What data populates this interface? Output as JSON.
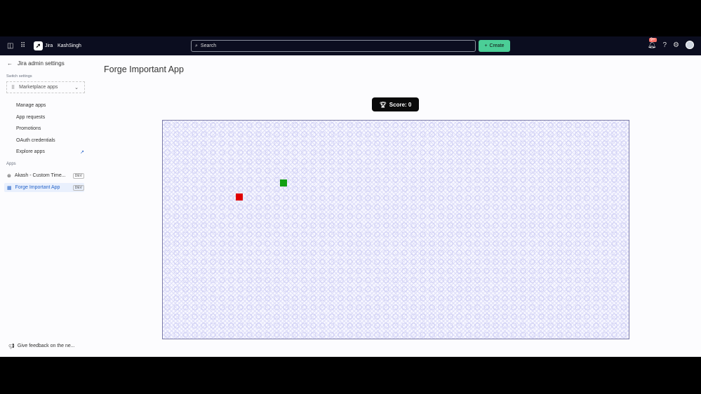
{
  "topbar": {
    "product": "Jira",
    "user": "KashSingh",
    "search_placeholder": "Search",
    "create_label": "Create",
    "notification_count": "9+"
  },
  "sidebar": {
    "back_label": "Jira admin settings",
    "switch_label": "Switch settings",
    "select_value": "Marketplace apps",
    "items": [
      "Manage apps",
      "App requests",
      "Promotions",
      "OAuth credentials",
      "Explore apps"
    ],
    "apps_label": "Apps",
    "apps": [
      {
        "name": "Akash - Custom Time...",
        "badge": "DEV"
      },
      {
        "name": "Forge Important App",
        "badge": "DEV"
      }
    ],
    "feedback": "Give feedback on the ne..."
  },
  "main": {
    "title": "Forge Important App",
    "score_label": "Score: 0"
  },
  "game": {
    "player_color": "#e00000",
    "food_color": "#12a012"
  }
}
